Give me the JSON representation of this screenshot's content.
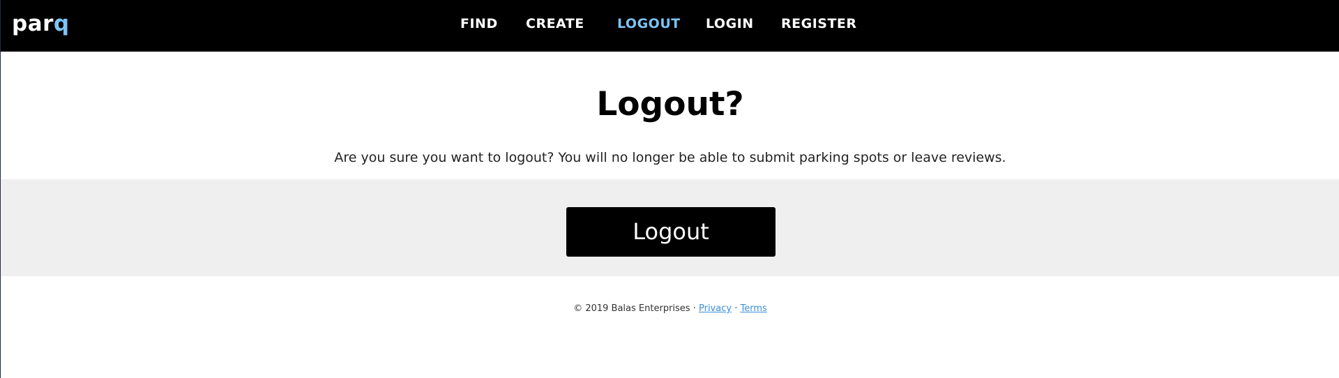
{
  "navbar": {
    "brand_main": "par",
    "brand_accent": "q",
    "items": [
      {
        "label": "FIND"
      },
      {
        "label": "CREATE"
      },
      {
        "label": "LOGOUT"
      },
      {
        "label": "LOGIN"
      },
      {
        "label": "REGISTER"
      }
    ],
    "active_item": "LOGOUT"
  },
  "main": {
    "title": "Logout?",
    "message": "Are you sure you want to logout? You will no longer be able to submit parking spots or leave reviews.",
    "button_label": "Logout"
  },
  "footer": {
    "copyright": "© 2019 Balas Enterprises ·",
    "separator": "·",
    "privacy_label": "Privacy",
    "terms_label": "Terms"
  },
  "colors": {
    "navbar_bg": "#000000",
    "accent": "#7cc3f4",
    "band_bg": "#efefef",
    "link": "#3b8fd6"
  }
}
